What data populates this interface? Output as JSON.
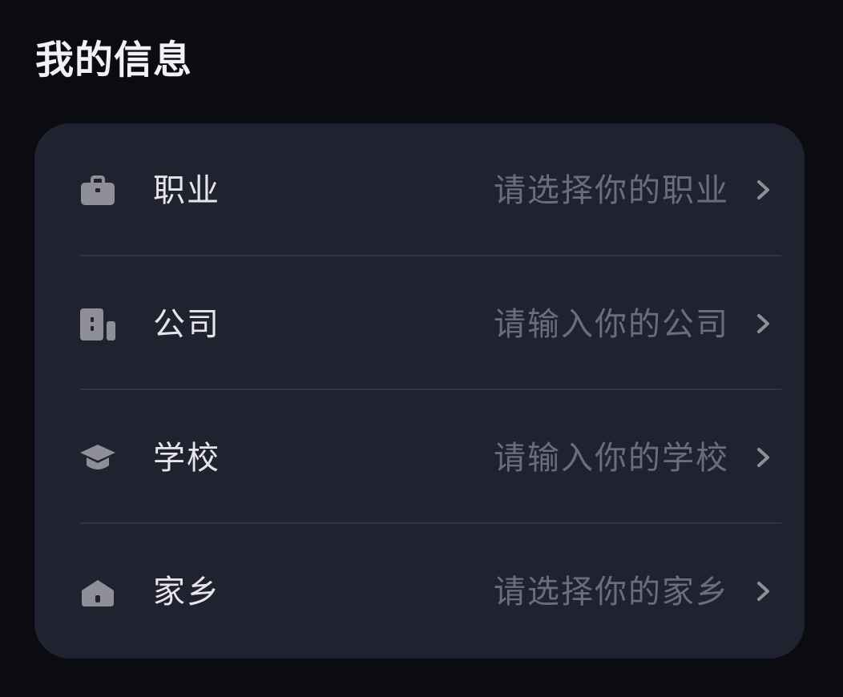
{
  "page": {
    "title": "我的信息"
  },
  "colors": {
    "background": "#0b0c12",
    "card": "#212230",
    "label": "#e6e6ea",
    "placeholder": "#6c6d7a",
    "icon": "#8e8f99",
    "divider": "#34353f"
  },
  "info_items": [
    {
      "icon": "briefcase-icon",
      "label": "职业",
      "value": "请选择你的职业"
    },
    {
      "icon": "building-icon",
      "label": "公司",
      "value": "请输入你的公司"
    },
    {
      "icon": "graduation-cap-icon",
      "label": "学校",
      "value": "请输入你的学校"
    },
    {
      "icon": "home-icon",
      "label": "家乡",
      "value": "请选择你的家乡"
    }
  ]
}
